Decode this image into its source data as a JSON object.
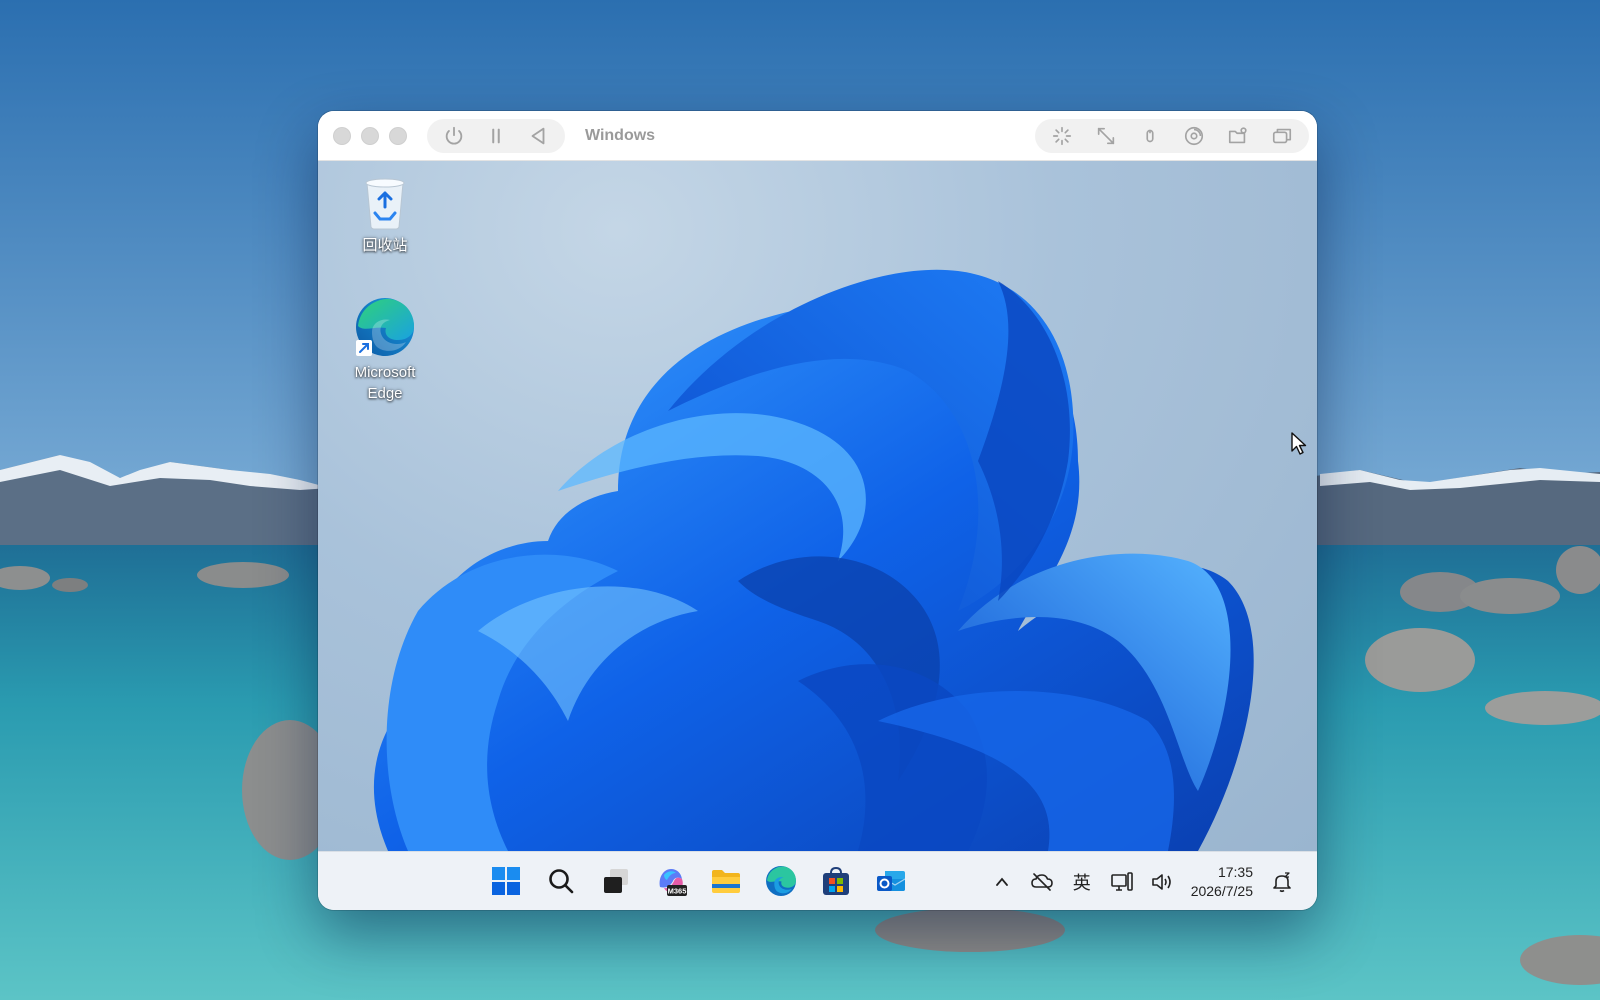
{
  "window": {
    "title": "Windows"
  },
  "titlebar": {
    "left_controls": [
      "power-icon",
      "pause-icon",
      "back-icon"
    ],
    "right_controls": [
      "tools-sparkle-icon",
      "resize-icon",
      "mouse-icon",
      "disc-icon",
      "shared-folder-icon",
      "multi-window-icon"
    ]
  },
  "desktop": {
    "icons": [
      {
        "label": "回收站",
        "icon": "recycle-bin-icon"
      },
      {
        "label": "Microsoft Edge",
        "icon": "edge-icon"
      }
    ]
  },
  "taskbar": {
    "apps": [
      "windows-start-icon",
      "search-icon",
      "task-view-icon",
      "m365-copilot-icon",
      "file-explorer-icon",
      "edge-icon",
      "microsoft-store-icon",
      "outlook-icon"
    ],
    "m365_badge": "M365",
    "tray": {
      "ime": "英",
      "time": "17:35",
      "date": "2026/7/25"
    }
  },
  "colors": {
    "accent": "#1a73e8",
    "win_blue": "#0a64e0",
    "taskbar_bg": "#eef2f7"
  }
}
